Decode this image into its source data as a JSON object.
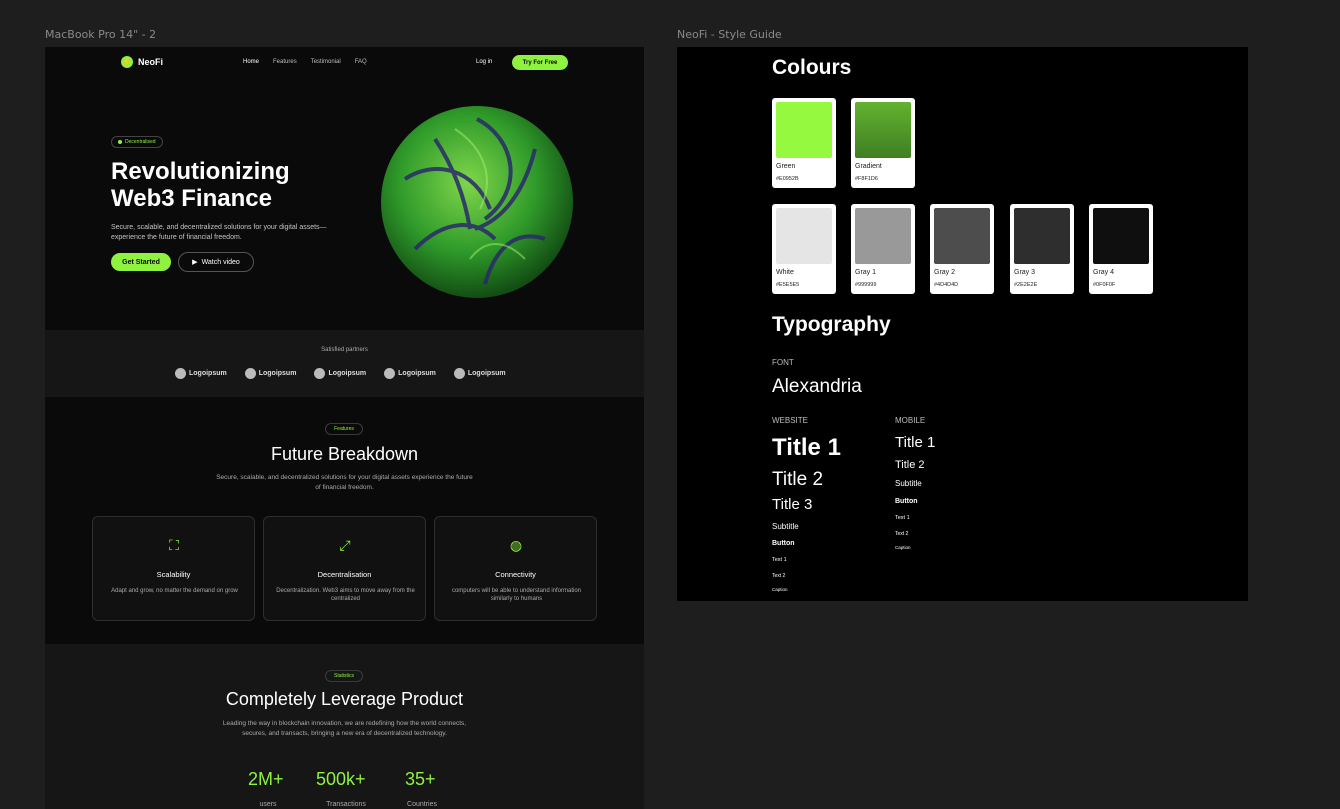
{
  "canvas": {
    "frame1_label": "MacBook Pro 14\" - 2",
    "frame2_label": "NeoFi - Style Guide"
  },
  "landing": {
    "logo_text": "NeoFi",
    "nav_links": [
      "Home",
      "Features",
      "Testimonial",
      "FAQ"
    ],
    "login": "Log in",
    "try_button": "Try For Free",
    "hero": {
      "badge": "Decentralised",
      "title_line1": "Revolutionizing",
      "title_line2": "Web3 Finance",
      "subtitle": "Secure, scalable, and decentralized solutions for your digital assets—experience the future of financial freedom.",
      "primary_button": "Get Started",
      "secondary_button": "Watch video"
    },
    "partners": {
      "title": "Satisfied partners",
      "logos": [
        "Logoipsum",
        "Logoipsum",
        "Logoipsum",
        "Logoipsum",
        "Logoipsum"
      ]
    },
    "features": {
      "pill": "Features",
      "title": "Future Breakdown",
      "subtitle": "Secure, scalable, and decentralized solutions for your digital assets experience the future of financial freedom.",
      "cards": [
        {
          "icon": "scale-icon",
          "title": "Scalability",
          "desc": "Adapt and grow, no matter the demand on grow"
        },
        {
          "icon": "expand-icon",
          "title": "Decentralisation",
          "desc": "Decentralization. Web3 aims to move away from the centralized"
        },
        {
          "icon": "globe-icon",
          "title": "Connectivity",
          "desc": "computers will be able to understand information similarly to humans"
        }
      ]
    },
    "statistics": {
      "pill": "Statistics",
      "title": "Completely Leverage Product",
      "subtitle": "Leading the way in blockchain innovation, we are redefining how the world connects, secures, and transacts, bringing a new era of decentralized technology.",
      "items": [
        {
          "value": "2M+",
          "label": "users"
        },
        {
          "value": "500k+",
          "label": "Transactions"
        },
        {
          "value": "35+",
          "label": "Countries"
        }
      ]
    }
  },
  "guide": {
    "colours_title": "Colours",
    "swatches_row1": [
      {
        "name": "Green",
        "hex": "#E0952B",
        "color": "#95fa3f"
      },
      {
        "name": "Gradient",
        "hex": "#F8F1D6",
        "color": "#4d9a2a"
      }
    ],
    "swatches_row2": [
      {
        "name": "White",
        "hex": "#E5E5E5",
        "color": "#e5e5e5"
      },
      {
        "name": "Gray 1",
        "hex": "#999999",
        "color": "#999999"
      },
      {
        "name": "Gray 2",
        "hex": "#4D4D4D",
        "color": "#4d4d4d"
      },
      {
        "name": "Gray 3",
        "hex": "#2E2E2E",
        "color": "#2e2e2e"
      },
      {
        "name": "Gray 4",
        "hex": "#0F0F0F",
        "color": "#0f0f0f"
      }
    ],
    "typography_title": "Typography",
    "font_label": "FONT",
    "font_name": "Alexandria",
    "website_label": "WEBSITE",
    "mobile_label": "MOBILE",
    "website_styles": [
      "Title 1",
      "Title 2",
      "Title 3",
      "Subtitle",
      "Button",
      "Text 1",
      "Text 2",
      "Caption"
    ],
    "mobile_styles": [
      "Title 1",
      "Title 2",
      "Subtitle",
      "Button",
      "Text 1",
      "Text 2",
      "Caption"
    ]
  }
}
